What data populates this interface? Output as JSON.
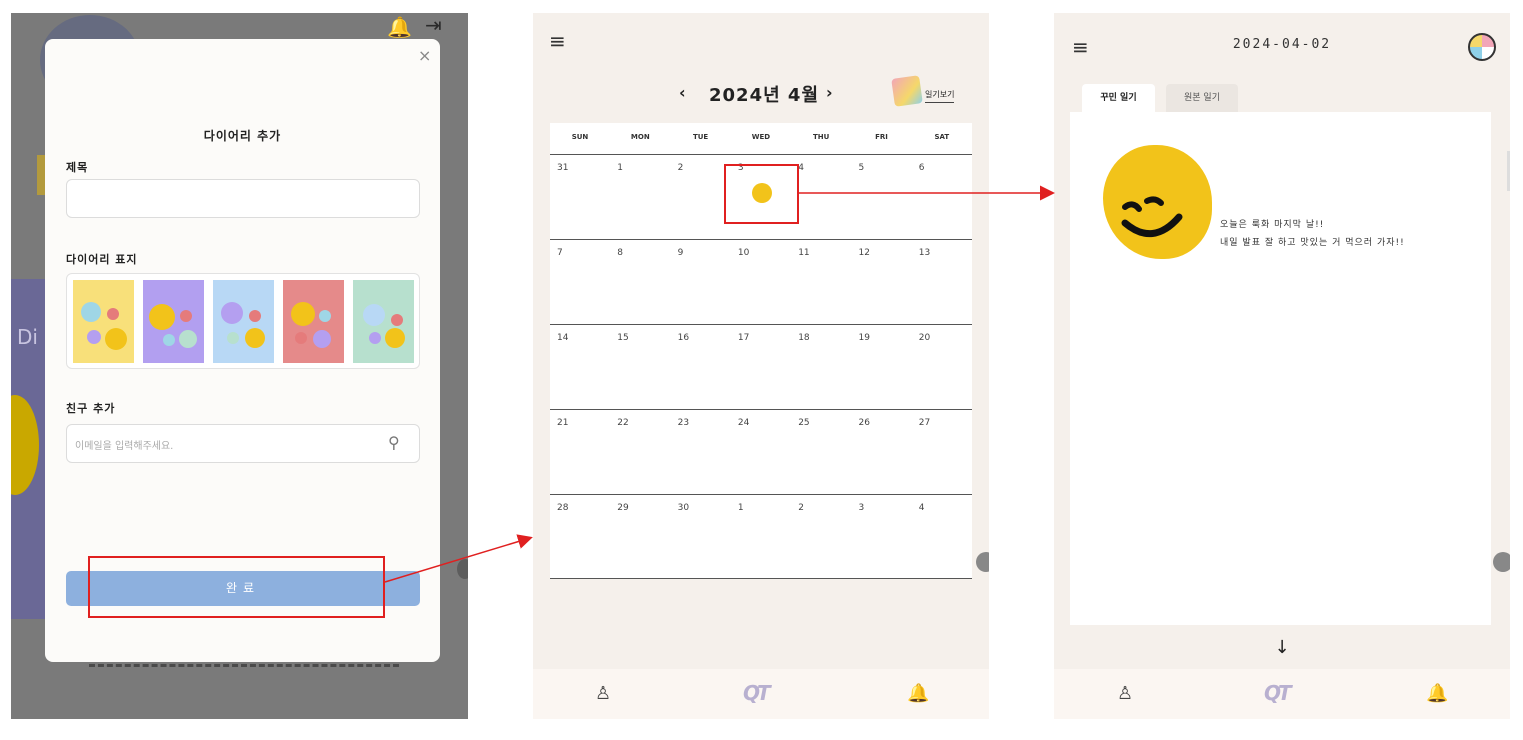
{
  "modal": {
    "title": "다이어리 추가",
    "close_glyph": "×",
    "title_field_label": "제목",
    "title_field_value": "",
    "cover_label": "다이어리 표지",
    "covers": [
      {
        "name": "yellow",
        "color": "#f8e07a"
      },
      {
        "name": "purple",
        "color": "#b29ff0"
      },
      {
        "name": "blue",
        "color": "#b8d8f5"
      },
      {
        "name": "red",
        "color": "#e58a8a"
      },
      {
        "name": "green",
        "color": "#b7e0ce"
      }
    ],
    "friend_label": "친구 추가",
    "friend_placeholder": "이메일을 입력해주세요.",
    "search_icon": "⚲",
    "done_label": "완료"
  },
  "background_screen": {
    "bell_icon": "🔔",
    "logout_icon": "⇥",
    "card_text": "Di"
  },
  "calendar": {
    "menu_icon": "≡",
    "prev_glyph": "‹",
    "next_glyph": "›",
    "month_title": "2024년 4월",
    "view_diary_label": "일기보기",
    "weekdays": [
      "SUN",
      "MON",
      "TUE",
      "WED",
      "THU",
      "FRI",
      "SAT"
    ],
    "weeks": [
      [
        "31",
        "1",
        "2",
        "3",
        "4",
        "5",
        "6"
      ],
      [
        "7",
        "8",
        "9",
        "10",
        "11",
        "12",
        "13"
      ],
      [
        "14",
        "15",
        "16",
        "17",
        "18",
        "19",
        "20"
      ],
      [
        "21",
        "22",
        "23",
        "24",
        "25",
        "26",
        "27"
      ],
      [
        "28",
        "29",
        "30",
        "1",
        "2",
        "3",
        "4"
      ]
    ],
    "emoji_date": "3",
    "tabbar": {
      "profile_icon": "♙",
      "logo": "QT",
      "bell_icon": "🔔"
    }
  },
  "diary": {
    "menu_icon": "≡",
    "date": "2024-04-02",
    "tabs": [
      "꾸민 일기",
      "원본 일기"
    ],
    "active_tab": "꾸민 일기",
    "lines": [
      "오늘은 룩화 마지막 날!!",
      "내일 발표 잘 하고 맛있는 거 먹으러 가자!!"
    ],
    "scroll_down_glyph": "↓",
    "tabbar": {
      "profile_icon": "♙",
      "logo": "QT",
      "bell_icon": "🔔"
    }
  },
  "colors": {
    "highlight": "#e02020",
    "accent_button": "#8db0de",
    "emoji_yellow": "#f2c31a",
    "app_background": "#f5f0eb"
  }
}
